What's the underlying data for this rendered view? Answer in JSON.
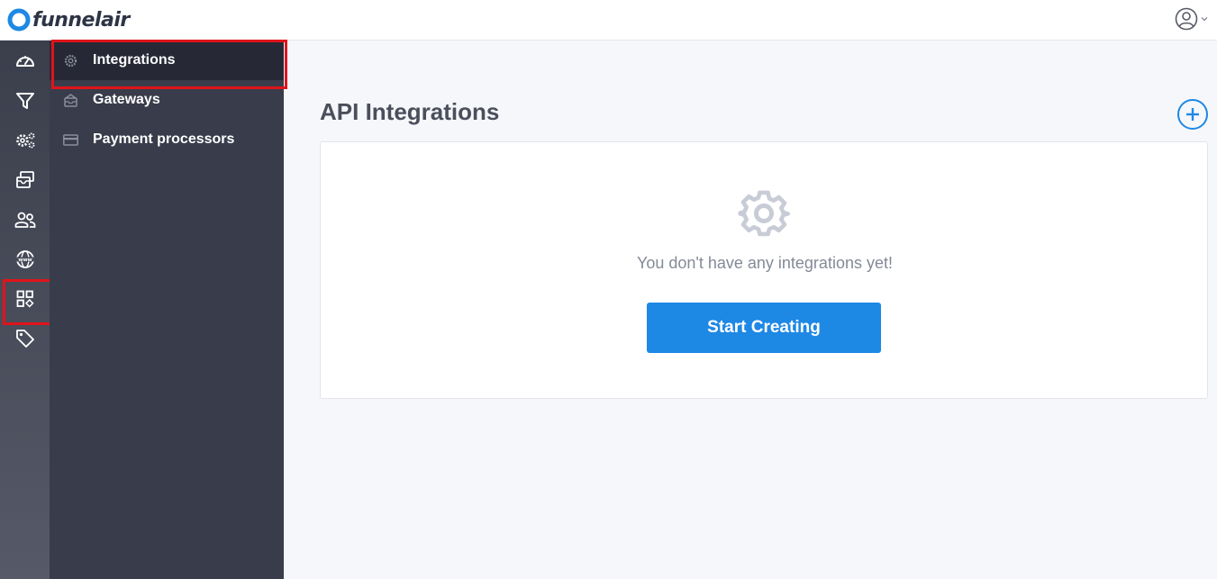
{
  "brand": {
    "name": "funnelair",
    "accent_color": "#1e88e5",
    "highlight_color": "#e0141b"
  },
  "header": {
    "user_menu_icon": "user-circle-icon",
    "dropdown_icon": "chevron-down-icon"
  },
  "rail": {
    "items": [
      {
        "icon": "dashboard-gauge-icon"
      },
      {
        "icon": "funnel-icon"
      },
      {
        "icon": "settings-gears-icon"
      },
      {
        "icon": "mail-inbox-icon"
      },
      {
        "icon": "users-icon"
      },
      {
        "icon": "globe-www-icon"
      },
      {
        "icon": "apps-grid-icon",
        "highlighted": true
      },
      {
        "icon": "tag-icon"
      }
    ]
  },
  "subnav": {
    "items": [
      {
        "label": "Integrations",
        "icon": "gear-icon",
        "active": true
      },
      {
        "label": "Gateways",
        "icon": "mailbox-icon"
      },
      {
        "label": "Payment processors",
        "icon": "credit-card-icon"
      }
    ]
  },
  "main": {
    "title": "API Integrations",
    "add_icon": "plus-circle-icon",
    "empty_state": {
      "icon": "gear-icon",
      "message": "You don't have any integrations yet!",
      "button_label": "Start Creating"
    }
  }
}
